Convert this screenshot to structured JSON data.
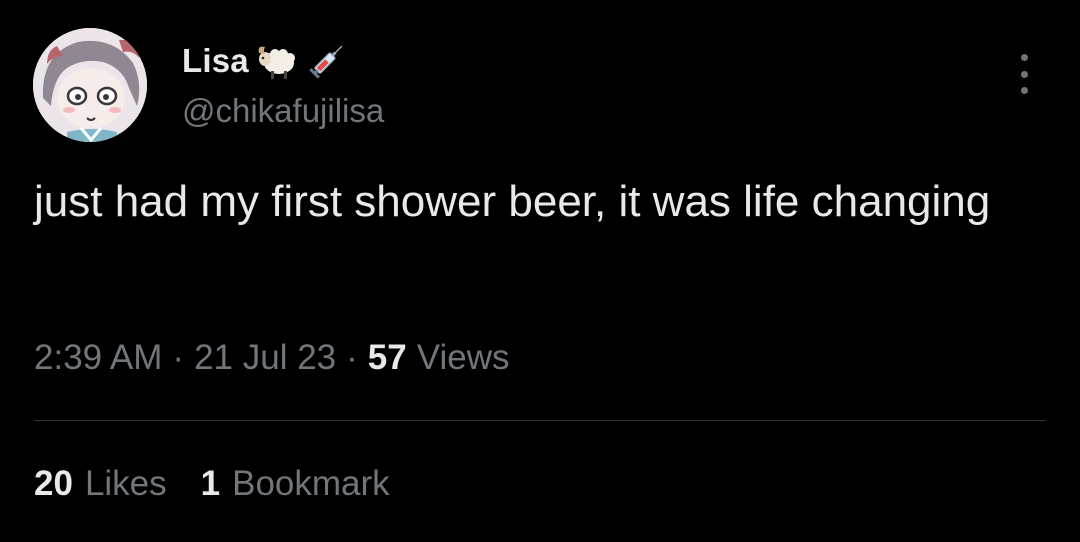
{
  "author": {
    "display_name": "Lisa",
    "name_emojis": [
      "sheep-emoji",
      "syringe-emoji"
    ],
    "handle": "@chikafujilisa"
  },
  "tweet": {
    "text": "just had my first shower beer, it was life changing",
    "time": "2:39 AM",
    "separator": "·",
    "date": "21 Jul 23",
    "views_count": "57",
    "views_label": "Views"
  },
  "stats": {
    "likes_count": "20",
    "likes_label": "Likes",
    "bookmarks_count": "1",
    "bookmarks_label": "Bookmark"
  },
  "icons": {
    "more": "more-vertical-icon"
  },
  "colors": {
    "background": "#000000",
    "primary_text": "#e7e9ea",
    "secondary_text": "#71767b",
    "divider": "#2f3336"
  }
}
